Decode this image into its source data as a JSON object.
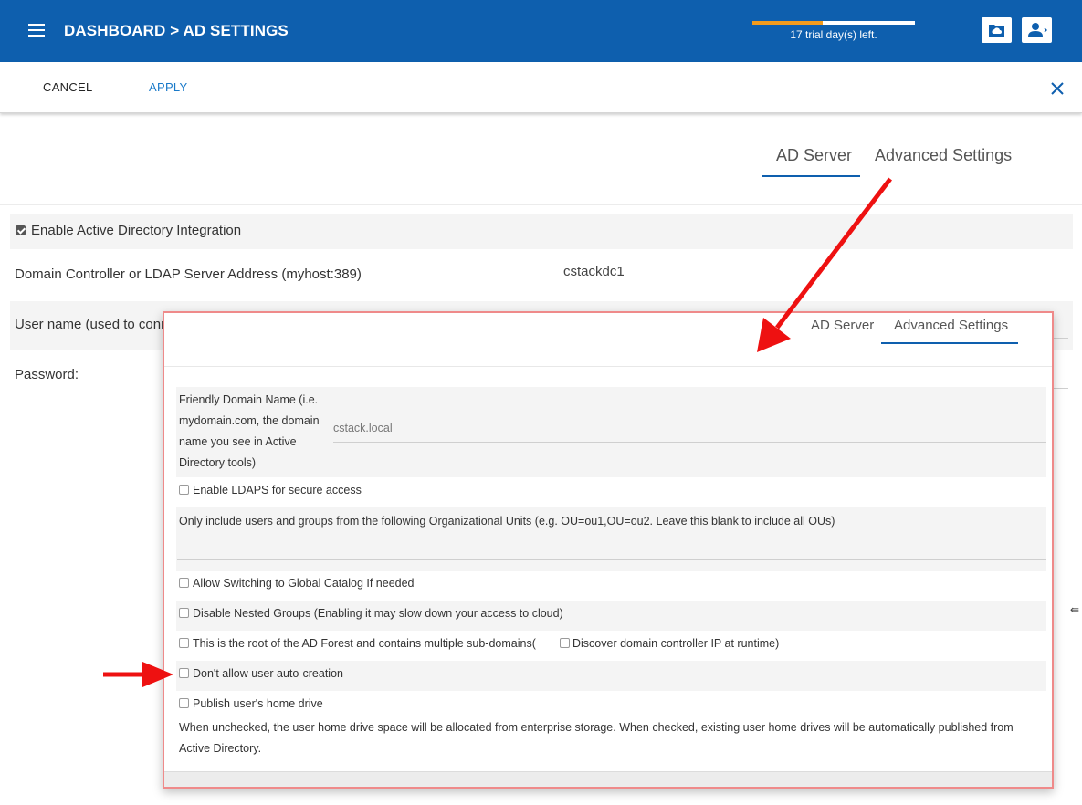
{
  "header": {
    "breadcrumb": "DASHBOARD > AD SETTINGS",
    "trial_text": "17 trial day(s) left.",
    "trial_progress": 0.43,
    "brand_color": "#0e5fae",
    "trial_color": "#f29b1d",
    "buttons": [
      "cloud-folder-icon",
      "user-switch-icon"
    ]
  },
  "actions": {
    "cancel": "CANCEL",
    "apply": "APPLY"
  },
  "tabs": {
    "ad_server": "AD Server",
    "advanced": "Advanced Settings"
  },
  "background_form": {
    "enable_ad": "Enable Active Directory Integration",
    "domain_controller_label": "Domain Controller or LDAP Server Address (myhost:389)",
    "domain_controller_value": "cstackdc1",
    "username_label": "User name (used to conn",
    "password_label": "Password:"
  },
  "advanced": {
    "friendly_domain_label": "Friendly Domain Name (i.e. mydomain.com, the domain name you see in Active Directory tools)",
    "friendly_domain_placeholder": "cstack.local",
    "enable_ldaps": "Enable LDAPS for secure access",
    "ou_label": "Only include users and groups from the following Organizational Units (e.g. OU=ou1,OU=ou2. Leave this blank to include all OUs)",
    "global_catalog": "Allow Switching to Global Catalog If needed",
    "disable_nested": "Disable Nested Groups (Enabling it may slow down your access to cloud)",
    "root_forest": "This is the root of the AD Forest and contains multiple sub-domains(",
    "discover_dc": "Discover domain controller IP at runtime)",
    "no_auto_creation": "Don't allow user auto-creation",
    "publish_home": "Publish user's home drive",
    "publish_home_note": "When unchecked, the user home drive space will be allocated from enterprise storage. When checked, existing user home drives will be automatically published from Active Directory."
  },
  "annotation_color": "#ee1111"
}
